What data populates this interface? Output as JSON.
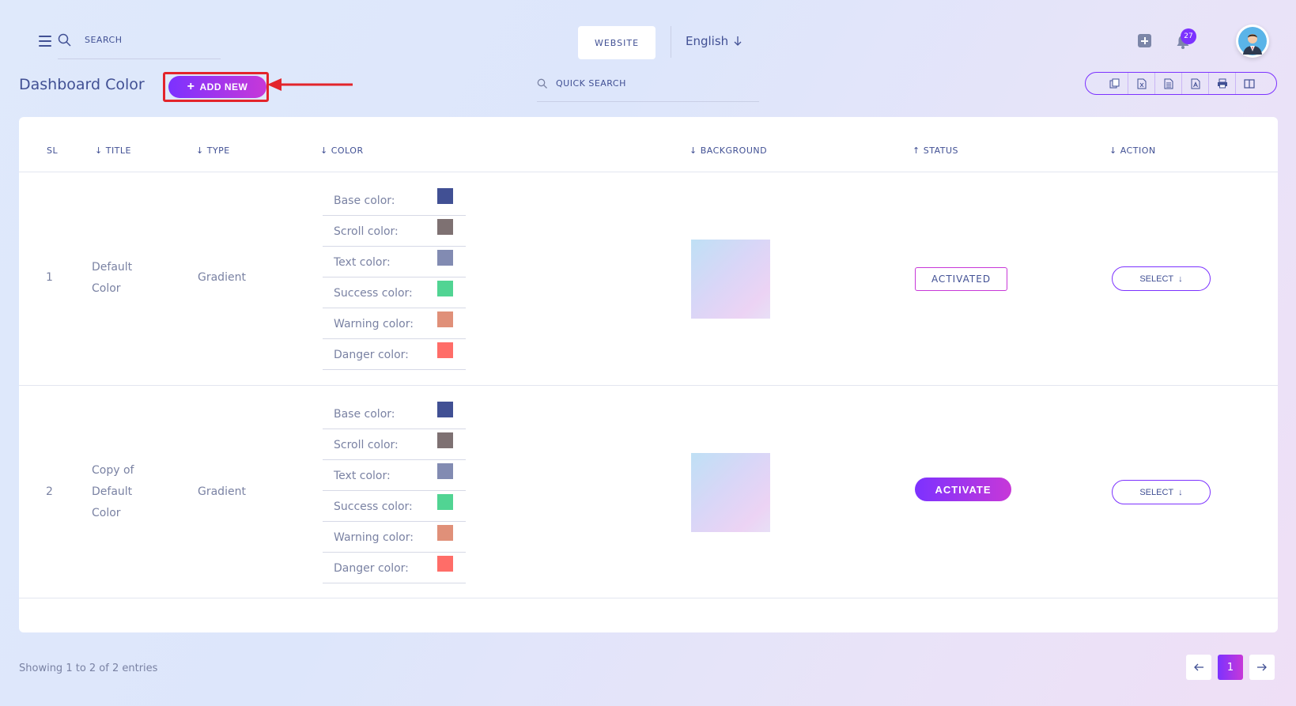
{
  "topbar": {
    "search_placeholder": "SEARCH",
    "website_label": "WEBSITE",
    "language": "English",
    "notification_count": "27"
  },
  "header": {
    "title": "Dashboard Color",
    "add_new_label": "ADD NEW",
    "quick_search_placeholder": "QUICK SEARCH"
  },
  "table": {
    "columns": [
      "SL",
      "TITLE",
      "TYPE",
      "COLOR",
      "BACKGROUND",
      "STATUS",
      "ACTION"
    ],
    "rows": [
      {
        "sl": "1",
        "title_lines": [
          "Default",
          "Color"
        ],
        "type": "Gradient",
        "colors": [
          {
            "label": "Base color:",
            "hex": "#415094"
          },
          {
            "label": "Scroll color:",
            "hex": "#7e7172"
          },
          {
            "label": "Text color:",
            "hex": "#828bb2"
          },
          {
            "label": "Success color:",
            "hex": "#51d493"
          },
          {
            "label": "Warning color:",
            "hex": "#e09079"
          },
          {
            "label": "Danger color:",
            "hex": "#ff6d68"
          }
        ],
        "status": "ACTIVATED",
        "action": "SELECT"
      },
      {
        "sl": "2",
        "title_lines": [
          "Copy of",
          "Default",
          "Color"
        ],
        "type": "Gradient",
        "colors": [
          {
            "label": "Base color:",
            "hex": "#415094"
          },
          {
            "label": "Scroll color:",
            "hex": "#7e7172"
          },
          {
            "label": "Text color:",
            "hex": "#828bb2"
          },
          {
            "label": "Success color:",
            "hex": "#51d493"
          },
          {
            "label": "Warning color:",
            "hex": "#e09079"
          },
          {
            "label": "Danger color:",
            "hex": "#ff6d68"
          }
        ],
        "status": "ACTIVATE",
        "action": "SELECT"
      }
    ]
  },
  "footer": {
    "showing": "Showing 1 to 2 of 2 entries",
    "current_page": "1"
  },
  "colors": {
    "accent_start": "#7c32ff",
    "accent_end": "#c738d8",
    "text_primary": "#415094",
    "annotation_red": "#e3242b"
  }
}
